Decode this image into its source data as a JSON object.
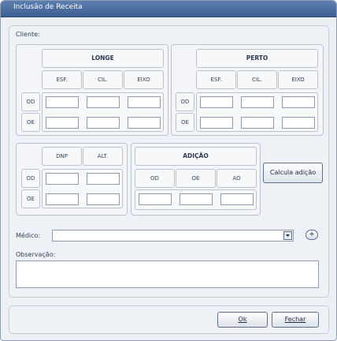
{
  "window": {
    "title": "Inclusão de Receita"
  },
  "form": {
    "cliente_label": "Cliente:"
  },
  "longe": {
    "header": "LONGE",
    "cols": [
      "ESF.",
      "CIL.",
      "EIXO"
    ]
  },
  "perto": {
    "header": "PERTO",
    "cols": [
      "ESF.",
      "CIL.",
      "EIXO"
    ]
  },
  "rows": {
    "od": "OD",
    "oe": "OE"
  },
  "dnp_group": {
    "cols": [
      "DNP",
      "ALT."
    ]
  },
  "adicao": {
    "header": "ADIÇÃO",
    "cols": [
      "OD",
      "OE",
      "AO"
    ]
  },
  "calcula_button": "Calcula adição",
  "medico": {
    "label": "Médico:",
    "value": "",
    "add_label": "+"
  },
  "observacao": {
    "label": "Observação:",
    "value": ""
  },
  "footer": {
    "ok_label": "Ok",
    "fechar_label": "Fechar"
  },
  "colors": {
    "titlebar": "#4a6ea3",
    "panel": "#eef1f5",
    "border": "#b9c2cf"
  }
}
